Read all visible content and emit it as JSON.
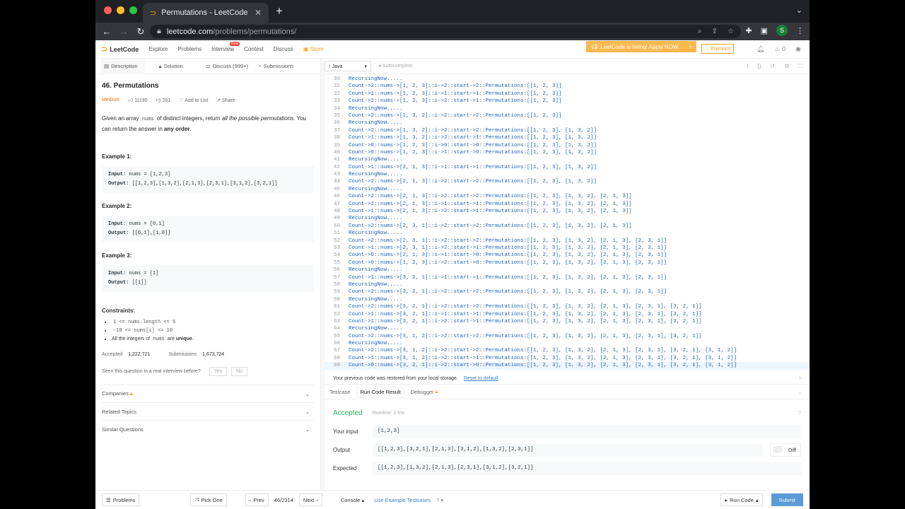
{
  "browser": {
    "tab_title": "Permutations - LeetCode",
    "url_domain": "leetcode.com",
    "url_path": "/problems/permutations/",
    "profile_initial": "S"
  },
  "nav": {
    "logo": "LeetCode",
    "links": [
      "Explore",
      "Problems",
      "Interview",
      "Contest",
      "Discuss"
    ],
    "store": "Store",
    "new_badge": "New",
    "hiring": "LeetCode is hiring! Apply NOW.",
    "premium": "Premium",
    "points": "0"
  },
  "left_tabs": [
    "Description",
    "Solution",
    "Discuss (999+)",
    "Submissions"
  ],
  "problem": {
    "title": "46. Permutations",
    "difficulty": "Medium",
    "likes": "11195",
    "dislikes": "201",
    "add_to_list": "Add to List",
    "share": "Share",
    "desc_1": "Given an array ",
    "desc_code": "nums",
    "desc_2": " of distinct integers, return ",
    "desc_italic": "all the possible permutations",
    "desc_3": ". You can return the answer in ",
    "desc_bold": "any order",
    "desc_4": ".",
    "examples": [
      {
        "heading": "Example 1:",
        "input": "nums = [1,2,3]",
        "output": "[[1,2,3],[1,3,2],[2,1,3],[2,3,1],[3,1,2],[3,2,1]]"
      },
      {
        "heading": "Example 2:",
        "input": "nums = [0,1]",
        "output": "[[0,1],[1,0]]"
      },
      {
        "heading": "Example 3:",
        "input": "nums = [1]",
        "output": "[[1]]"
      }
    ],
    "input_label": "Input:",
    "output_label": "Output:",
    "constraints_heading": "Constraints:",
    "constraint_1": "1 <= nums.length <= 6",
    "constraint_2": "-10 <= nums[i] <= 10",
    "constraint_3_pre": "All the integers of ",
    "constraint_3_code": "nums",
    "constraint_3_mid": " are ",
    "constraint_3_bold": "unique",
    "constraint_3_end": ".",
    "accepted_label": "Accepted",
    "accepted": "1,222,721",
    "submissions_label": "Submissions",
    "submissions": "1,673,724",
    "seen_question": "Seen this question in a real interview before?",
    "yes": "Yes",
    "no": "No",
    "accordions": [
      "Companies",
      "Related Topics",
      "Similar Questions"
    ]
  },
  "editor": {
    "language": "Java",
    "autocomplete": "Autocomplete",
    "lines": [
      {
        "n": "30",
        "t": "RecursingNow....."
      },
      {
        "n": "31",
        "t": "Count->2::nums->[1, 2, 3]::i->2::start->2::Permutations:[[1, 2, 3]]"
      },
      {
        "n": "32",
        "t": "Count->1::nums->[1, 2, 3]::i->1::start->1::Permutations:[[1, 2, 3]]"
      },
      {
        "n": "33",
        "t": "Count->1::nums->[1, 2, 3]::i->2::start->1::Permutations:[[1, 2, 3]]"
      },
      {
        "n": "34",
        "t": "RecursingNow....."
      },
      {
        "n": "35",
        "t": "Count->2::nums->[1, 3, 2]::i->2::start->2::Permutations:[[1, 2, 3]]"
      },
      {
        "n": "36",
        "t": "RecursingNow....."
      },
      {
        "n": "37",
        "t": "Count->2::nums->[1, 3, 2]::i->2::start->2::Permutations:[[1, 2, 3], [1, 3, 2]]"
      },
      {
        "n": "38",
        "t": "Count->1::nums->[1, 3, 2]::i->2::start->1::Permutations:[[1, 2, 3], [1, 3, 2]]"
      },
      {
        "n": "39",
        "t": "Count->0::nums->[1, 2, 3]::i->0::start->0::Permutations:[[1, 2, 3], [1, 3, 2]]"
      },
      {
        "n": "40",
        "t": "Count->0::nums->[1, 2, 3]::i->1::start->0::Permutations:[[1, 2, 3], [1, 3, 2]]"
      },
      {
        "n": "41",
        "t": "RecursingNow....."
      },
      {
        "n": "42",
        "t": "Count->1::nums->[2, 1, 3]::i->1::start->1::Permutations:[[1, 2, 3], [1, 3, 2]]"
      },
      {
        "n": "43",
        "t": "RecursingNow....."
      },
      {
        "n": "44",
        "t": "Count->2::nums->[2, 1, 3]::i->2::start->2::Permutations:[[1, 2, 3], [1, 3, 2]]"
      },
      {
        "n": "45",
        "t": "RecursingNow....."
      },
      {
        "n": "46",
        "t": "Count->2::nums->[2, 1, 3]::i->2::start->2::Permutations:[[1, 2, 3], [1, 3, 2], [2, 1, 3]]"
      },
      {
        "n": "47",
        "t": "Count->1::nums->[2, 1, 3]::i->1::start->1::Permutations:[[1, 2, 3], [1, 3, 2], [2, 1, 3]]"
      },
      {
        "n": "48",
        "t": "Count->1::nums->[2, 1, 3]::i->2::start->1::Permutations:[[1, 2, 3], [1, 3, 2], [2, 1, 3]]"
      },
      {
        "n": "49",
        "t": "RecursingNow....."
      },
      {
        "n": "50",
        "t": "Count->2::nums->[2, 3, 1]::i->2::start->2::Permutations:[[1, 2, 3], [1, 3, 2], [2, 1, 3]]"
      },
      {
        "n": "51",
        "t": "RecursingNow....."
      },
      {
        "n": "52",
        "t": "Count->2::nums->[2, 3, 1]::i->2::start->2::Permutations:[[1, 2, 3], [1, 3, 2], [2, 1, 3], [2, 3, 1]]"
      },
      {
        "n": "53",
        "t": "Count->1::nums->[2, 3, 1]::i->2::start->1::Permutations:[[1, 2, 3], [1, 3, 2], [2, 1, 3], [2, 3, 1]]"
      },
      {
        "n": "54",
        "t": "Count->0::nums->[2, 1, 3]::i->1::start->0::Permutations:[[1, 2, 3], [1, 3, 2], [2, 1, 3], [2, 3, 1]]"
      },
      {
        "n": "55",
        "t": "Count->0::nums->[1, 2, 3]::i->2::start->0::Permutations:[[1, 2, 3], [1, 3, 2], [2, 1, 3], [2, 3, 1]]"
      },
      {
        "n": "56",
        "t": "RecursingNow....."
      },
      {
        "n": "57",
        "t": "Count->1::nums->[3, 2, 1]::i->1::start->1::Permutations:[[1, 2, 3], [1, 3, 2], [2, 1, 3], [2, 3, 1]]"
      },
      {
        "n": "58",
        "t": "RecursingNow....."
      },
      {
        "n": "59",
        "t": "Count->2::nums->[3, 2, 1]::i->2::start->2::Permutations:[[1, 2, 3], [1, 3, 2], [2, 1, 3], [2, 3, 1]]"
      },
      {
        "n": "60",
        "t": "RecursingNow....."
      },
      {
        "n": "61",
        "t": "Count->2::nums->[3, 2, 1]::i->2::start->2::Permutations:[[1, 2, 3], [1, 3, 2], [2, 1, 3], [2, 3, 1], [3, 2, 1]]"
      },
      {
        "n": "62",
        "t": "Count->1::nums->[3, 2, 1]::i->1::start->1::Permutations:[[1, 2, 3], [1, 3, 2], [2, 1, 3], [2, 3, 1], [3, 2, 1]]"
      },
      {
        "n": "63",
        "t": "Count->1::nums->[3, 2, 1]::i->2::start->1::Permutations:[[1, 2, 3], [1, 3, 2], [2, 1, 3], [2, 3, 1], [3, 2, 1]]"
      },
      {
        "n": "64",
        "t": "RecursingNow....."
      },
      {
        "n": "65",
        "t": "Count->2::nums->[3, 1, 2]::i->2::start->2::Permutations:[[1, 2, 3], [1, 3, 2], [2, 1, 3], [2, 3, 1], [3, 2, 1]]"
      },
      {
        "n": "66",
        "t": "RecursingNow....."
      },
      {
        "n": "67",
        "t": "Count->2::nums->[3, 1, 2]::i->2::start->2::Permutations:[[1, 2, 3], [1, 3, 2], [2, 1, 3], [2, 3, 1], [3, 2, 1], [3, 1, 2]]"
      },
      {
        "n": "68",
        "t": "Count->1::nums->[3, 1, 2]::i->2::start->1::Permutations:[[1, 2, 3], [1, 3, 2], [2, 1, 3], [2, 3, 1], [3, 2, 1], [3, 1, 2]]"
      },
      {
        "n": "69",
        "t": "Count->0::nums->[3, 2, 1]::i->2::start->0::Permutations:[[1, 2, 3], [1, 3, 2], [2, 1, 3], [2, 3, 1], [3, 2, 1], [3, 1, 2]]"
      }
    ]
  },
  "restored": {
    "message": "Your previous code was restored from your local storage.",
    "reset": "Reset to default"
  },
  "bottom_tabs": [
    "Testcase",
    "Run Code Result",
    "Debugger"
  ],
  "result": {
    "status": "Accepted",
    "runtime": "Runtime: 1 ms",
    "input_label": "Your input",
    "input": "[1,2,3]",
    "output_label": "Output",
    "output": "[[1,2,3],[3,2,1],[2,1,3],[3,1,2],[1,3,2],[2,3,1]]",
    "diff": "Diff",
    "expected_label": "Expected",
    "expected": "[[1,2,3],[1,3,2],[2,1,3],[2,3,1],[3,1,2],[3,2,1]]"
  },
  "footer": {
    "problems": "Problems",
    "pick_one": "Pick One",
    "prev": "Prev",
    "page": "46/2314",
    "next": "Next",
    "console": "Console",
    "use_example": "Use Example Testcases",
    "run_code": "Run Code",
    "submit": "Submit"
  }
}
